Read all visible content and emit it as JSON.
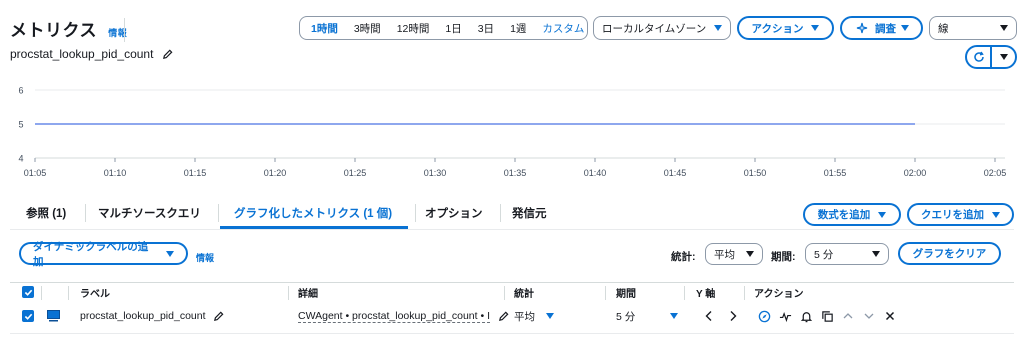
{
  "header": {
    "title": "メトリクス",
    "info": "情報",
    "metric_name": "procstat_lookup_pid_count"
  },
  "time_range": {
    "items": [
      "1時間",
      "3時間",
      "12時間",
      "1日",
      "3日",
      "1週"
    ],
    "active": "1時間",
    "custom": "カスタム"
  },
  "timezone_select": "ローカルタイムゾーン",
  "actions_button": "アクション",
  "investigate_button": "調査",
  "chart_type_select": "線",
  "chart_data": {
    "type": "line",
    "x": [
      "01:05",
      "01:10",
      "01:15",
      "01:20",
      "01:25",
      "01:30",
      "01:35",
      "01:40",
      "01:45",
      "01:50",
      "01:55",
      "02:00",
      "02:05"
    ],
    "yticks": [
      "6",
      "5",
      "4"
    ],
    "ylim": [
      4,
      6
    ],
    "series": [
      {
        "values": [
          5,
          5,
          5,
          5,
          5,
          5,
          5,
          5,
          5,
          5,
          5,
          5
        ],
        "color": "#688ae8"
      }
    ],
    "grid": true
  },
  "tabs": [
    {
      "label": "参照 (1)"
    },
    {
      "label": "マルチソースクエリ"
    },
    {
      "label": "グラフ化したメトリクス (1 個)"
    },
    {
      "label": "オプション"
    },
    {
      "label": "発信元"
    }
  ],
  "add_math_button": "数式を追加",
  "add_query_button": "クエリを追加",
  "dynamic_label_button": "ダイナミックラベルの追加",
  "dynamic_label_info": "情報",
  "stat_label": "統計:",
  "stat_select": "平均",
  "period_label": "期間:",
  "period_select": "5 分",
  "clear_graph_button": "グラフをクリア",
  "table": {
    "headers": [
      "ラベル",
      "詳細",
      "統計",
      "期間",
      "Y 軸",
      "アクション"
    ],
    "row": {
      "label": "procstat_lookup_pid_count",
      "details": "CWAgent • procstat_lookup_pid_count • I",
      "stat": "平均",
      "period": "5 分"
    }
  },
  "colors": {
    "accent": "#0972d3",
    "series": "#688ae8"
  }
}
